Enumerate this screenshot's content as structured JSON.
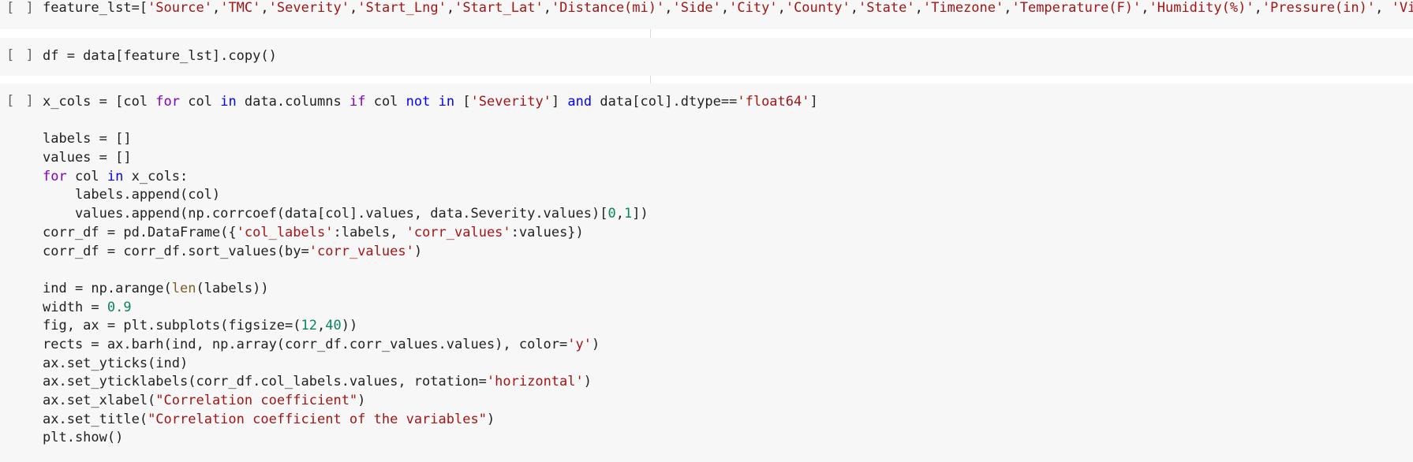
{
  "cells": [
    {
      "id": "cell-1",
      "run_label": "[ ]",
      "lines": [
        [
          {
            "t": "feature_lst=[",
            "c": ""
          },
          {
            "t": "'Source'",
            "c": "str"
          },
          {
            "t": ",",
            "c": ""
          },
          {
            "t": "'TMC'",
            "c": "str"
          },
          {
            "t": ",",
            "c": ""
          },
          {
            "t": "'Severity'",
            "c": "str"
          },
          {
            "t": ",",
            "c": ""
          },
          {
            "t": "'Start_Lng'",
            "c": "str"
          },
          {
            "t": ",",
            "c": ""
          },
          {
            "t": "'Start_Lat'",
            "c": "str"
          },
          {
            "t": ",",
            "c": ""
          },
          {
            "t": "'Distance(mi)'",
            "c": "str"
          },
          {
            "t": ",",
            "c": ""
          },
          {
            "t": "'Side'",
            "c": "str"
          },
          {
            "t": ",",
            "c": ""
          },
          {
            "t": "'City'",
            "c": "str"
          },
          {
            "t": ",",
            "c": ""
          },
          {
            "t": "'County'",
            "c": "str"
          },
          {
            "t": ",",
            "c": ""
          },
          {
            "t": "'State'",
            "c": "str"
          },
          {
            "t": ",",
            "c": ""
          },
          {
            "t": "'Timezone'",
            "c": "str"
          },
          {
            "t": ",",
            "c": ""
          },
          {
            "t": "'Temperature(F)'",
            "c": "str"
          },
          {
            "t": ",",
            "c": ""
          },
          {
            "t": "'Humidity(%)'",
            "c": "str"
          },
          {
            "t": ",",
            "c": ""
          },
          {
            "t": "'Pressure(in)'",
            "c": "str"
          },
          {
            "t": ", ",
            "c": ""
          },
          {
            "t": "'Visibility(mi",
            "c": "str"
          }
        ]
      ]
    },
    {
      "id": "cell-2",
      "run_label": "[ ]",
      "lines": [
        [
          {
            "t": "df = data[feature_lst].copy()",
            "c": ""
          }
        ]
      ]
    },
    {
      "id": "cell-3",
      "run_label": "[ ]",
      "lines": [
        [
          {
            "t": "x_cols = [col ",
            "c": ""
          },
          {
            "t": "for",
            "c": "kw"
          },
          {
            "t": " col ",
            "c": ""
          },
          {
            "t": "in",
            "c": "kw2"
          },
          {
            "t": " data.columns ",
            "c": ""
          },
          {
            "t": "if",
            "c": "kw"
          },
          {
            "t": " col ",
            "c": ""
          },
          {
            "t": "not in",
            "c": "kw2"
          },
          {
            "t": " [",
            "c": ""
          },
          {
            "t": "'Severity'",
            "c": "str"
          },
          {
            "t": "] ",
            "c": ""
          },
          {
            "t": "and",
            "c": "kw2"
          },
          {
            "t": " data[col].dtype==",
            "c": ""
          },
          {
            "t": "'float64'",
            "c": "str"
          },
          {
            "t": "]",
            "c": ""
          }
        ],
        [],
        [
          {
            "t": "labels = []",
            "c": ""
          }
        ],
        [
          {
            "t": "values = []",
            "c": ""
          }
        ],
        [
          {
            "t": "for",
            "c": "kw"
          },
          {
            "t": " col ",
            "c": ""
          },
          {
            "t": "in",
            "c": "kw2"
          },
          {
            "t": " x_cols:",
            "c": ""
          }
        ],
        [
          {
            "t": "    labels.append(col)",
            "c": ""
          }
        ],
        [
          {
            "t": "    values.append(np.corrcoef(data[col].values, data.Severity.values)[",
            "c": ""
          },
          {
            "t": "0",
            "c": "num"
          },
          {
            "t": ",",
            "c": ""
          },
          {
            "t": "1",
            "c": "num"
          },
          {
            "t": "])",
            "c": ""
          }
        ],
        [
          {
            "t": "corr_df = pd.DataFrame({",
            "c": ""
          },
          {
            "t": "'col_labels'",
            "c": "str"
          },
          {
            "t": ":labels, ",
            "c": ""
          },
          {
            "t": "'corr_values'",
            "c": "str"
          },
          {
            "t": ":values})",
            "c": ""
          }
        ],
        [
          {
            "t": "corr_df = corr_df.sort_values(by=",
            "c": ""
          },
          {
            "t": "'corr_values'",
            "c": "str"
          },
          {
            "t": ")",
            "c": ""
          }
        ],
        [],
        [
          {
            "t": "ind = np.arange(",
            "c": ""
          },
          {
            "t": "len",
            "c": "fn"
          },
          {
            "t": "(labels))",
            "c": ""
          }
        ],
        [
          {
            "t": "width = ",
            "c": ""
          },
          {
            "t": "0.9",
            "c": "num"
          }
        ],
        [
          {
            "t": "fig, ax = plt.subplots(figsize=(",
            "c": ""
          },
          {
            "t": "12",
            "c": "num"
          },
          {
            "t": ",",
            "c": ""
          },
          {
            "t": "40",
            "c": "num"
          },
          {
            "t": "))",
            "c": ""
          }
        ],
        [
          {
            "t": "rects = ax.barh(ind, np.array(corr_df.corr_values.values), color=",
            "c": ""
          },
          {
            "t": "'y'",
            "c": "str"
          },
          {
            "t": ")",
            "c": ""
          }
        ],
        [
          {
            "t": "ax.set_yticks(ind)",
            "c": ""
          }
        ],
        [
          {
            "t": "ax.set_yticklabels(corr_df.col_labels.values, rotation=",
            "c": ""
          },
          {
            "t": "'horizontal'",
            "c": "str"
          },
          {
            "t": ")",
            "c": ""
          }
        ],
        [
          {
            "t": "ax.set_xlabel(",
            "c": ""
          },
          {
            "t": "\"Correlation coefficient\"",
            "c": "str"
          },
          {
            "t": ")",
            "c": ""
          }
        ],
        [
          {
            "t": "ax.set_title(",
            "c": ""
          },
          {
            "t": "\"Correlation coefficient of the variables\"",
            "c": "str"
          },
          {
            "t": ")",
            "c": ""
          }
        ],
        [
          {
            "t": "plt.show()",
            "c": ""
          }
        ]
      ]
    }
  ]
}
